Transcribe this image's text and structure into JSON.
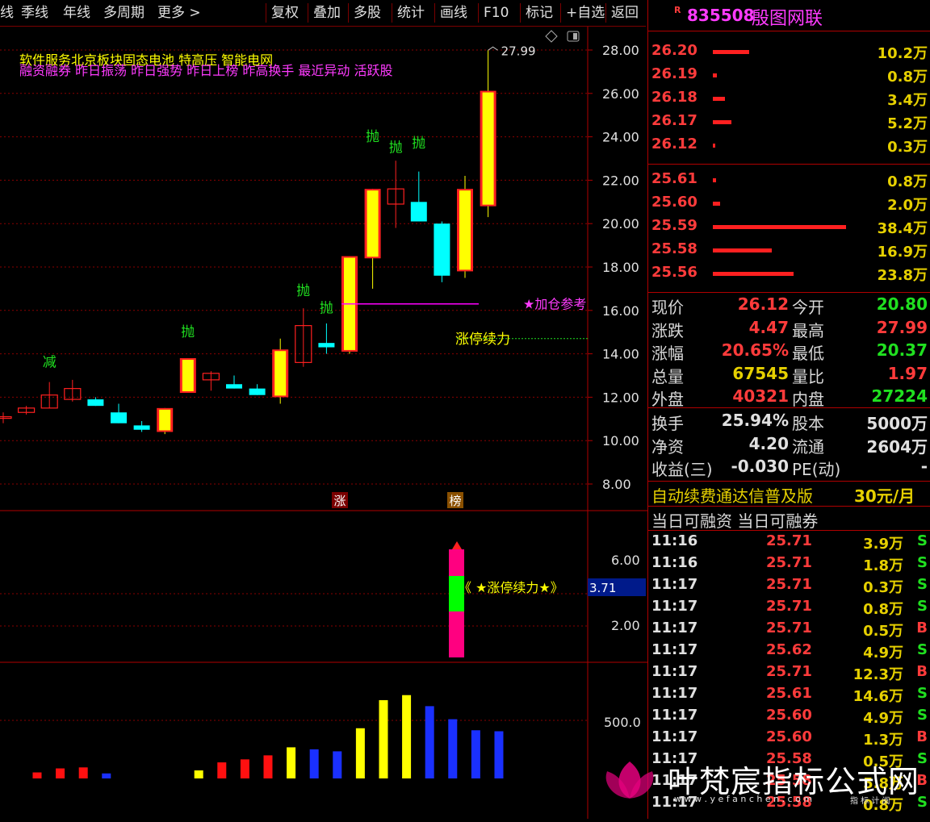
{
  "toolbar": {
    "items": [
      "线",
      "季线",
      "年线",
      "多周期",
      "更多 >",
      "复权",
      "叠加",
      "多股",
      "统计",
      "画线",
      "F10",
      "标记",
      "+自选",
      "返回"
    ]
  },
  "stock": {
    "badge": "R",
    "code": "835508",
    "name": "殷图网联"
  },
  "chart": {
    "tags_line1": "软件服务北京板块固态电池 特高压 智能电网",
    "tags_line2": "融资融券 昨日振荡 昨日强势 昨日上榜 昨高换手 最近异动 活跃股",
    "price_axis": [
      "28.00",
      "26.00",
      "24.00",
      "22.00",
      "20.00",
      "18.00",
      "16.00",
      "14.00",
      "12.00",
      "10.00",
      "8.00"
    ],
    "high_label": "27.99",
    "annot_add": "★加仓参考",
    "annot_cont": "涨停续力",
    "marker_zhang": "涨",
    "marker_bang": "榜",
    "signal_jian": "减",
    "signal_pao": "抛",
    "ind_axis": [
      "6.00",
      "2.00"
    ],
    "ind_value": "3.71",
    "ind_label": "《 ★涨停续力★》",
    "vol_axis": "500.0",
    "colors": {
      "up": "#ff2020",
      "down": "#00ffff",
      "yellow": "#ffff00",
      "blue": "#0030ff",
      "magenta": "#ff00ff"
    }
  },
  "chart_data": {
    "type": "candlestick",
    "ylim": [
      8,
      28
    ],
    "candles": [
      {
        "o": 11.1,
        "h": 11.3,
        "l": 10.8,
        "c": 11.1,
        "color": "up"
      },
      {
        "o": 11.3,
        "h": 11.6,
        "l": 11.2,
        "c": 11.5,
        "color": "up"
      },
      {
        "o": 11.5,
        "h": 12.7,
        "l": 11.5,
        "c": 12.1,
        "color": "up"
      },
      {
        "o": 11.9,
        "h": 12.8,
        "l": 11.8,
        "c": 12.4,
        "color": "up"
      },
      {
        "o": 11.9,
        "h": 12.0,
        "l": 11.6,
        "c": 11.6,
        "color": "down"
      },
      {
        "o": 11.3,
        "h": 11.7,
        "l": 10.8,
        "c": 10.8,
        "color": "down"
      },
      {
        "o": 10.7,
        "h": 10.9,
        "l": 10.4,
        "c": 10.5,
        "color": "down"
      },
      {
        "o": 10.4,
        "h": 11.5,
        "l": 10.3,
        "c": 11.5,
        "color": "yellow"
      },
      {
        "o": 12.2,
        "h": 13.8,
        "l": 12.2,
        "c": 13.8,
        "color": "yellow"
      },
      {
        "o": 12.8,
        "h": 13.2,
        "l": 12.3,
        "c": 13.1,
        "color": "up"
      },
      {
        "o": 12.6,
        "h": 13.0,
        "l": 12.4,
        "c": 12.4,
        "color": "down"
      },
      {
        "o": 12.4,
        "h": 12.6,
        "l": 12.1,
        "c": 12.1,
        "color": "down"
      },
      {
        "o": 12.0,
        "h": 14.7,
        "l": 11.7,
        "c": 14.2,
        "color": "yellow"
      },
      {
        "o": 13.6,
        "h": 16.1,
        "l": 13.4,
        "c": 15.3,
        "color": "up"
      },
      {
        "o": 14.5,
        "h": 15.4,
        "l": 14.0,
        "c": 14.3,
        "color": "down"
      },
      {
        "o": 14.1,
        "h": 18.5,
        "l": 14.0,
        "c": 18.5,
        "color": "yellow"
      },
      {
        "o": 18.4,
        "h": 21.6,
        "l": 17.0,
        "c": 21.6,
        "color": "yellow"
      },
      {
        "o": 20.9,
        "h": 22.9,
        "l": 19.8,
        "c": 21.6,
        "color": "up"
      },
      {
        "o": 21.0,
        "h": 22.4,
        "l": 20.1,
        "c": 20.1,
        "color": "down"
      },
      {
        "o": 20.0,
        "h": 20.1,
        "l": 17.3,
        "c": 17.6,
        "color": "down"
      },
      {
        "o": 17.8,
        "h": 22.2,
        "l": 17.5,
        "c": 21.6,
        "color": "yellow"
      },
      {
        "o": 20.8,
        "h": 27.99,
        "l": 20.3,
        "c": 26.12,
        "color": "yellow"
      }
    ],
    "volume": [
      {
        "v": 60,
        "color": "red"
      },
      {
        "v": 100,
        "color": "red"
      },
      {
        "v": 110,
        "color": "red"
      },
      {
        "v": 50,
        "color": "blue"
      },
      {
        "v": 0,
        "color": "none"
      },
      {
        "v": 0,
        "color": "none"
      },
      {
        "v": 0,
        "color": "none"
      },
      {
        "v": 80,
        "color": "yellow"
      },
      {
        "v": 160,
        "color": "red"
      },
      {
        "v": 190,
        "color": "red"
      },
      {
        "v": 230,
        "color": "red"
      },
      {
        "v": 310,
        "color": "yellow"
      },
      {
        "v": 290,
        "color": "blue"
      },
      {
        "v": 270,
        "color": "blue"
      },
      {
        "v": 500,
        "color": "yellow"
      },
      {
        "v": 780,
        "color": "yellow"
      },
      {
        "v": 830,
        "color": "yellow"
      },
      {
        "v": 720,
        "color": "blue"
      },
      {
        "v": 590,
        "color": "blue"
      },
      {
        "v": 480,
        "color": "blue"
      },
      {
        "v": 470,
        "color": "blue"
      }
    ],
    "signal_reference_price": 16.3,
    "continuation_price": 14.7
  },
  "orderbook": {
    "asks": [
      {
        "price": "26.20",
        "vol": "10.2万",
        "bar": 45
      },
      {
        "price": "26.19",
        "vol": "0.8万",
        "bar": 5
      },
      {
        "price": "26.18",
        "vol": "3.4万",
        "bar": 15
      },
      {
        "price": "26.17",
        "vol": "5.2万",
        "bar": 23
      },
      {
        "price": "26.12",
        "vol": "0.3万",
        "bar": 3
      }
    ],
    "bids": [
      {
        "price": "25.61",
        "vol": "0.8万",
        "bar": 4
      },
      {
        "price": "25.60",
        "vol": "2.0万",
        "bar": 9
      },
      {
        "price": "25.59",
        "vol": "38.4万",
        "bar": 165
      },
      {
        "price": "25.58",
        "vol": "16.9万",
        "bar": 73
      },
      {
        "price": "25.56",
        "vol": "23.8万",
        "bar": 100
      }
    ]
  },
  "quote": {
    "rows": [
      {
        "l1": "现价",
        "v1": "26.12",
        "c1": "red",
        "l2": "今开",
        "v2": "20.80",
        "c2": "green"
      },
      {
        "l1": "涨跌",
        "v1": "4.47",
        "c1": "red",
        "l2": "最高",
        "v2": "27.99",
        "c2": "red"
      },
      {
        "l1": "涨幅",
        "v1": "20.65%",
        "c1": "red",
        "l2": "最低",
        "v2": "20.37",
        "c2": "green"
      },
      {
        "l1": "总量",
        "v1": "67545",
        "c1": "yellow",
        "l2": "量比",
        "v2": "1.97",
        "c2": "red"
      },
      {
        "l1": "外盘",
        "v1": "40321",
        "c1": "red",
        "l2": "内盘",
        "v2": "27224",
        "c2": "green"
      }
    ],
    "rows2": [
      {
        "l1": "换手",
        "v1": "25.94%",
        "l2": "股本",
        "v2": "5000万"
      },
      {
        "l1": "净资",
        "v1": "4.20",
        "l2": "流通",
        "v2": "2604万"
      },
      {
        "l1": "收益(三)",
        "v1": "-0.030",
        "l2": "PE(动)",
        "v2": "-"
      }
    ]
  },
  "promo": {
    "text": "自动续费通达信普及版",
    "price": "30元/月"
  },
  "margin_line": "当日可融资 当日可融券",
  "ticks": [
    {
      "t": "11:16",
      "p": "25.71",
      "v": "3.9万",
      "bs": "S"
    },
    {
      "t": "11:16",
      "p": "25.71",
      "v": "1.8万",
      "bs": "S"
    },
    {
      "t": "11:17",
      "p": "25.71",
      "v": "0.3万",
      "bs": "S"
    },
    {
      "t": "11:17",
      "p": "25.71",
      "v": "0.8万",
      "bs": "S"
    },
    {
      "t": "11:17",
      "p": "25.71",
      "v": "0.5万",
      "bs": "B"
    },
    {
      "t": "11:17",
      "p": "25.62",
      "v": "4.9万",
      "bs": "S"
    },
    {
      "t": "11:17",
      "p": "25.71",
      "v": "12.3万",
      "bs": "B"
    },
    {
      "t": "11:17",
      "p": "25.61",
      "v": "14.6万",
      "bs": "S"
    },
    {
      "t": "11:17",
      "p": "25.60",
      "v": "4.9万",
      "bs": "S"
    },
    {
      "t": "11:17",
      "p": "25.60",
      "v": "1.3万",
      "bs": "B"
    },
    {
      "t": "11:17",
      "p": "25.58",
      "v": "0.5万",
      "bs": "S"
    },
    {
      "t": "11:17",
      "p": "25.58",
      "v": "5.8万",
      "bs": "B"
    },
    {
      "t": "11:17",
      "p": "25.58",
      "v": "0.8万",
      "bs": "S"
    }
  ],
  "watermark": {
    "title": "叶梵宸指标公式网",
    "url": "w w w . y e f a n c h e n . c o m",
    "sub": "指 标 计 阅"
  }
}
